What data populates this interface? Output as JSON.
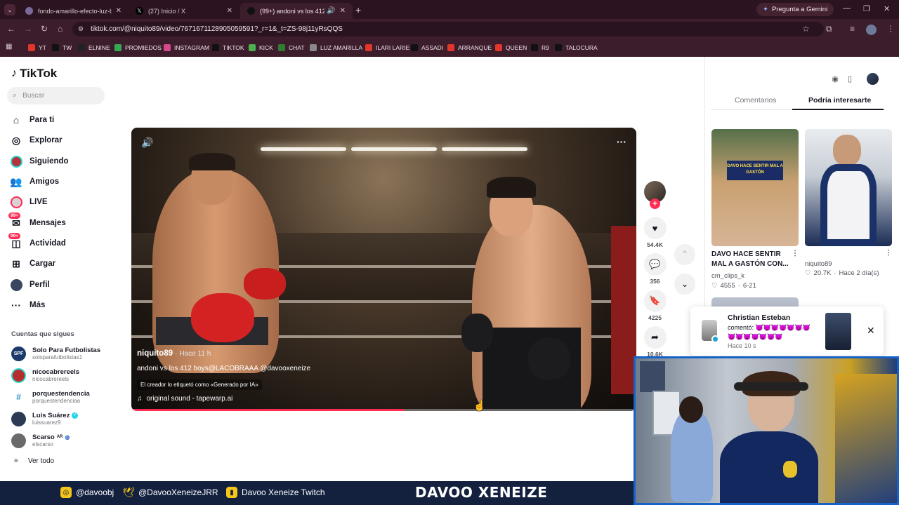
{
  "browser": {
    "tabs": [
      {
        "title": "fondo-amarillo-efecto-luz-brillante",
        "active": false
      },
      {
        "title": "(27) Inicio / X",
        "active": false
      },
      {
        "title": "(99+) andoni vs los 412 boys",
        "active": true
      }
    ],
    "gemini_label": "Pregunta a Gemini",
    "url": "tiktok.com/@niquito89/video/7671671128905059591?_r=1&_t=ZS-98j11yRsQQS",
    "bookmarks": [
      "YT",
      "TW",
      "ELNINE",
      "PROMIEDOS",
      "INSTAGRAM",
      "TIKTOK",
      "KICK",
      "CHAT",
      "LUZ AMARILLA",
      "ILARI LARIE",
      "ASSADI",
      "ARRANQUE",
      "QUEEN",
      "R9",
      "TALOCURA"
    ]
  },
  "sidebar": {
    "logo": "TikTok",
    "search_placeholder": "Buscar",
    "nav": [
      {
        "label": "Para ti",
        "icon": "home-icon"
      },
      {
        "label": "Explorar",
        "icon": "compass-icon"
      },
      {
        "label": "Siguiendo",
        "icon": "following-icon"
      },
      {
        "label": "Amigos",
        "icon": "friends-icon"
      },
      {
        "label": "LIVE",
        "icon": "live-icon"
      },
      {
        "label": "Mensajes",
        "icon": "messages-icon",
        "badge": "99+"
      },
      {
        "label": "Actividad",
        "icon": "activity-icon",
        "badge": "99+"
      },
      {
        "label": "Cargar",
        "icon": "upload-icon"
      },
      {
        "label": "Perfil",
        "icon": "profile-icon"
      },
      {
        "label": "Más",
        "icon": "more-icon"
      }
    ],
    "following_title": "Cuentas que sigues",
    "accounts": [
      {
        "name": "Solo Para Futbolistas",
        "handle": "soloparafutbolistas1",
        "avatar_text": "SPF",
        "color": "#1b3a6b",
        "verified": false
      },
      {
        "name": "nicocabrereels",
        "handle": "nicocabrereels",
        "avatar_text": "",
        "color": "#b52d2d",
        "verified": false
      },
      {
        "name": "porquestendencia",
        "handle": "porquestendenciaa",
        "avatar_text": "#",
        "color": "#ffffff",
        "verified": false
      },
      {
        "name": "Luis Suárez",
        "handle": "luissuarez9",
        "avatar_text": "",
        "color": "#2d3a55",
        "verified": true
      },
      {
        "name": "Scarso",
        "handle": "elscarso",
        "avatar_text": "",
        "color": "#6a6a6a",
        "verified": false,
        "suffix": "AR"
      }
    ],
    "see_all": "Ver todo"
  },
  "video": {
    "author": "niquito89",
    "time_ago": "· Hace 11 h",
    "description": "andoni vs los 412 boys@LACOBRAAA @davooxeneize",
    "ai_label": "El creador lo etiquetó como «Generado por IA»",
    "sound": "original sound - tapewarp.ai",
    "progress": 0.54
  },
  "actions": {
    "likes": "54.4K",
    "comments": "356",
    "saves": "4225",
    "shares": "10.6K"
  },
  "right_panel": {
    "tabs": [
      "Comentarios",
      "Podría interesarte"
    ],
    "active_tab": 1,
    "cards": [
      {
        "title": "DAVO HACE SENTIR MAL A GASTÓN CON...",
        "user": "cm_clips_k",
        "likes": "4555",
        "date": "6-21",
        "overlay": "DAVO HACE SENTIR MAL A GASTÓN"
      },
      {
        "title": "",
        "user": "niquito89",
        "likes": "20.7K",
        "date": "Hace 2 día(s)",
        "overlay": ""
      }
    ],
    "notification": {
      "name": "Christian Esteban",
      "text": "comentó: 😈😈😈😈😈😈😈😈😈😈😈😈😈😈",
      "time": "Hace 10 s"
    }
  },
  "stream_overlay": {
    "instagram": "@davoobj",
    "twitter": "@DavooXeneizeJRR",
    "twitch": "Davoo Xeneize Twitch",
    "brand": "DAVOO XENEIZE"
  },
  "colors": {
    "tiktok_red": "#fe2c55",
    "chrome_dark": "#2b1320",
    "stream_bar": "#13213f",
    "webcam_border": "#1663c7"
  }
}
